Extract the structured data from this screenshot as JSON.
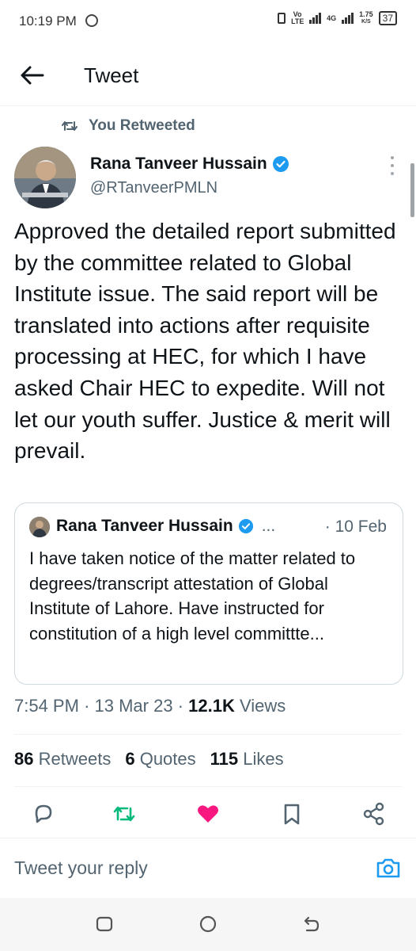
{
  "status_bar": {
    "time": "10:19 PM",
    "volte": "Vo LTE",
    "network": "4G",
    "speed": "1.75",
    "speed_unit": "K/S",
    "battery": "37",
    "icons": [
      "whatsapp-icon",
      "vibrate-icon",
      "signal-icon",
      "battery-icon"
    ]
  },
  "header": {
    "title": "Tweet",
    "back_icon": "back-arrow-icon"
  },
  "retweet_context": {
    "label": "You Retweeted",
    "icon": "retweet-icon"
  },
  "tweet": {
    "author_name": "Rana Tanveer Hussain",
    "author_handle": "@RTanveerPMLN",
    "verified": true,
    "text": "Approved the detailed report submitted by the committee related to Global Institute issue. The said report will be translated into actions after requisite processing at HEC, for which I have asked Chair HEC to expedite. Will not let our youth suffer. Justice & merit will prevail.",
    "time": "7:54 PM",
    "date": "13 Mar 23",
    "views_count": "12.1K",
    "views_label": "Views",
    "retweets_count": "86",
    "retweets_label": "Retweets",
    "quotes_count": "6",
    "quotes_label": "Quotes",
    "likes_count": "115",
    "likes_label": "Likes"
  },
  "quoted_tweet": {
    "author_name": "Rana Tanveer Hussain",
    "ellipsis": "...",
    "date": "· 10 Feb",
    "text": "I have taken notice of the matter related to degrees/transcript attestation of Global Institute of Lahore. Have instructed for constitution of a high level committte..."
  },
  "actions": [
    "reply-icon",
    "retweet-icon",
    "like-icon",
    "bookmark-icon",
    "share-icon"
  ],
  "reply": {
    "placeholder": "Tweet your reply"
  },
  "colors": {
    "accent": "#1d9bf0",
    "retweet_green": "#00ba7c",
    "like_pink": "#f91880",
    "muted": "#536471",
    "text": "#0f1419"
  }
}
